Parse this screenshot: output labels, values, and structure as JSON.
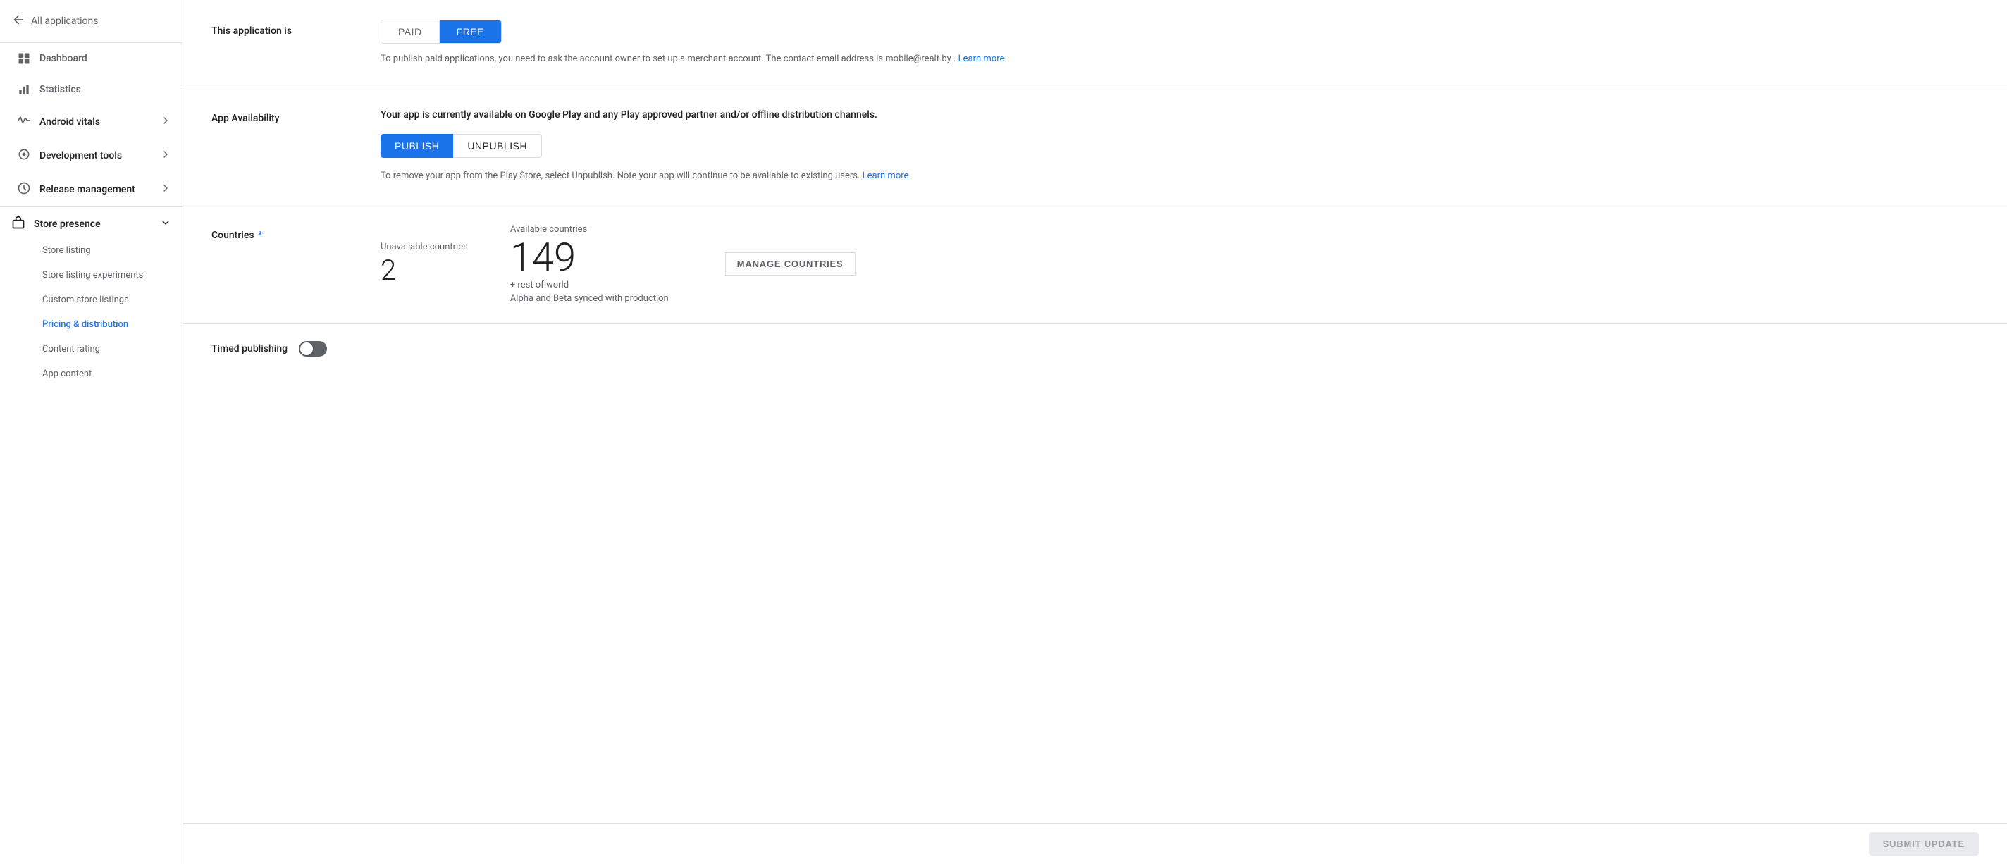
{
  "sidebar": {
    "back_label": "All applications",
    "nav_items": [
      {
        "id": "dashboard",
        "label": "Dashboard",
        "icon": "grid"
      },
      {
        "id": "statistics",
        "label": "Statistics",
        "icon": "bar-chart"
      },
      {
        "id": "android-vitals",
        "label": "Android vitals",
        "icon": "pulse",
        "has_children": true
      },
      {
        "id": "dev-tools",
        "label": "Development tools",
        "icon": "tools",
        "has_children": true
      },
      {
        "id": "release-mgmt",
        "label": "Release management",
        "icon": "rocket",
        "has_children": true
      }
    ],
    "store_presence": {
      "label": "Store presence",
      "icon": "bag",
      "children": [
        {
          "id": "store-listing",
          "label": "Store listing",
          "active": false
        },
        {
          "id": "store-listing-experiments",
          "label": "Store listing experiments",
          "active": false
        },
        {
          "id": "custom-store-listings",
          "label": "Custom store listings",
          "active": false
        },
        {
          "id": "pricing-distribution",
          "label": "Pricing & distribution",
          "active": true
        },
        {
          "id": "content-rating",
          "label": "Content rating",
          "active": false
        },
        {
          "id": "app-content",
          "label": "App content",
          "active": false
        }
      ]
    }
  },
  "pricing": {
    "section_label": "This application is",
    "paid_label": "PAID",
    "free_label": "FREE",
    "active": "free",
    "info_text": "To publish paid applications, you need to ask the account owner to set up a merchant account. The contact email address is mobile@realt.by .",
    "learn_more_label": "Learn more"
  },
  "availability": {
    "section_label": "App Availability",
    "description": "Your app is currently available on Google Play and any Play approved partner and/or offline distribution channels.",
    "publish_label": "PUBLISH",
    "unpublish_label": "UNPUBLISH",
    "info_text": "To remove your app from the Play Store, select Unpublish. Note your app will continue to be available to existing users.",
    "learn_more_label": "Learn more"
  },
  "countries": {
    "section_label": "Countries",
    "required": true,
    "unavailable_label": "Unavailable countries",
    "unavailable_count": "2",
    "available_label": "Available countries",
    "available_count": "149",
    "rest_of_world": "+ rest of world",
    "synced_text": "Alpha and Beta synced with production",
    "manage_label": "MANAGE COUNTRIES"
  },
  "timed_publishing": {
    "label": "Timed publishing",
    "enabled": false
  },
  "footer": {
    "submit_label": "SUBMIT UPDATE"
  }
}
